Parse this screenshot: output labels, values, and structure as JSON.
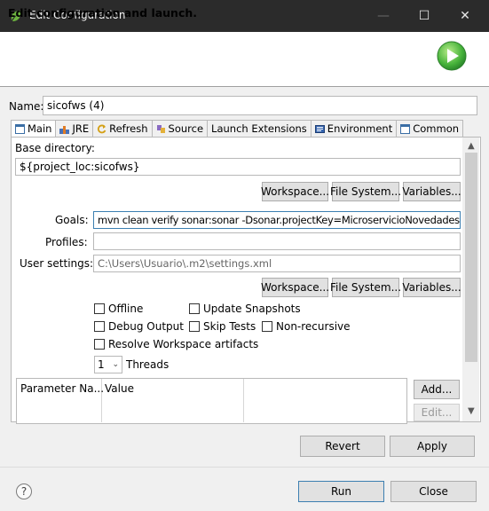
{
  "window": {
    "title": "Edit Configuration",
    "minimize_icon": "—",
    "maximize_icon": "☐",
    "close_icon": "✕"
  },
  "header": {
    "title": "Edit configuration and launch."
  },
  "name_row": {
    "label": "Name:",
    "value": "sicofws (4)"
  },
  "tabs": [
    {
      "label": "Main",
      "icon": "main-tab-icon",
      "active": true
    },
    {
      "label": "JRE",
      "icon": "jre-icon"
    },
    {
      "label": "Refresh",
      "icon": "refresh-icon"
    },
    {
      "label": "Source",
      "icon": "source-icon"
    },
    {
      "label": "Launch Extensions",
      "icon": ""
    },
    {
      "label": "Environment",
      "icon": "environment-icon"
    },
    {
      "label": "Common",
      "icon": "common-icon"
    }
  ],
  "main": {
    "base_directory": {
      "label": "Base directory:",
      "value": "${project_loc:sicofws}"
    },
    "buttons_row1": {
      "workspace": "Workspace...",
      "file_system": "File System...",
      "variables": "Variables..."
    },
    "goals": {
      "label": "Goals:",
      "value": "mvn clean verify sonar:sonar -Dsonar.projectKey=MicroservicioNovedadesEx"
    },
    "profiles": {
      "label": "Profiles:",
      "value": ""
    },
    "user_settings": {
      "label": "User settings:",
      "value": "C:\\Users\\Usuario\\.m2\\settings.xml"
    },
    "buttons_row2": {
      "workspace": "Workspace...",
      "file_system": "File System...",
      "variables": "Variables..."
    },
    "checkboxes": {
      "offline": "Offline",
      "update_snapshots": "Update Snapshots",
      "debug_output": "Debug Output",
      "skip_tests": "Skip Tests",
      "non_recursive": "Non-recursive",
      "resolve_workspace": "Resolve Workspace artifacts"
    },
    "threads": {
      "value": "1",
      "label": "Threads"
    },
    "parameter_table": {
      "columns": [
        "Parameter Na...",
        "Value"
      ]
    },
    "table_buttons": {
      "add": "Add...",
      "edit": "Edit..."
    }
  },
  "footer": {
    "revert": "Revert",
    "apply": "Apply",
    "run": "Run",
    "close": "Close",
    "help": "?"
  },
  "colors": {
    "titlebar": "#2b2b2b",
    "accent_green": "#3aa639",
    "primary_border": "#3c7fb1"
  }
}
